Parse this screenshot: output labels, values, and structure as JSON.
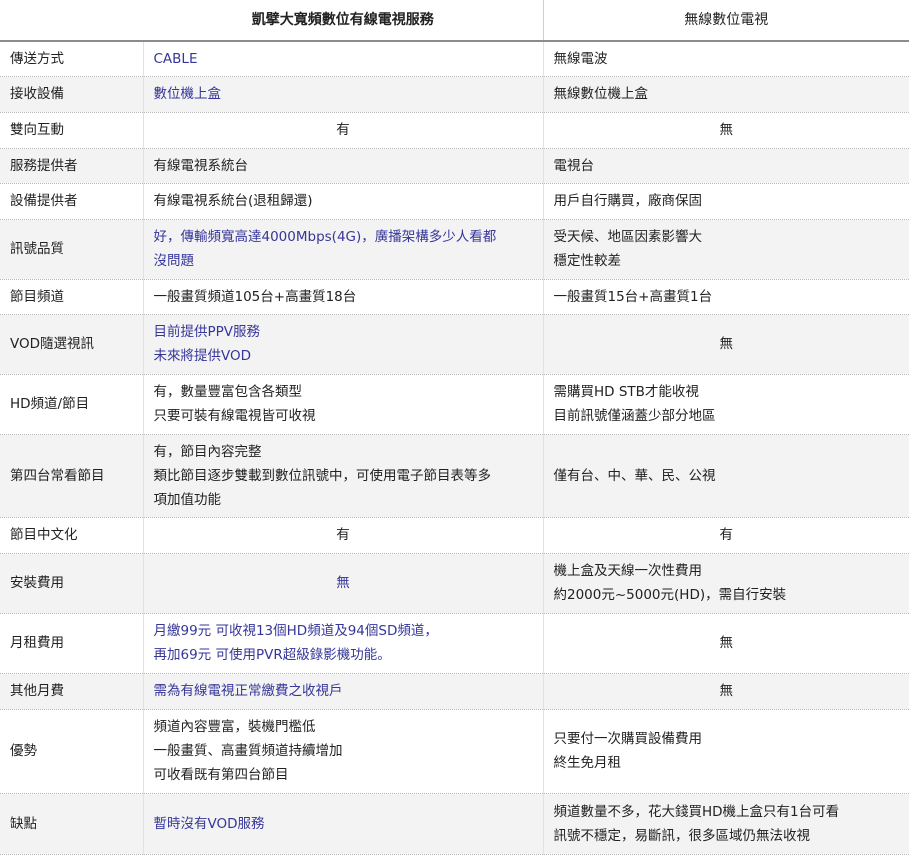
{
  "header": {
    "col0": "",
    "col1": "凱擘大寬頻數位有線電視服務",
    "col2": "無線數位電視"
  },
  "rows": [
    {
      "label": "傳送方式",
      "c1": [
        "CABLE"
      ],
      "c2": [
        "無線電波"
      ]
    },
    {
      "label": "接收設備",
      "c1": [
        "數位機上盒"
      ],
      "c2": [
        "無線數位機上盒"
      ]
    },
    {
      "label": "雙向互動",
      "c1": [
        "有"
      ],
      "c2": [
        "無"
      ]
    },
    {
      "label": "服務提供者",
      "c1": [
        "有線電視系統台"
      ],
      "c2": [
        "電視台"
      ]
    },
    {
      "label": "設備提供者",
      "c1": [
        "有線電視系統台(退租歸還)"
      ],
      "c2": [
        "用戶自行購買，廠商保固"
      ]
    },
    {
      "label": "訊號品質",
      "c1": [
        "好，傳輸頻寬高達4000Mbps(4G)，廣播架構多少人看都",
        "沒問題"
      ],
      "c2": [
        "受天候、地區因素影響大",
        "穩定性較差"
      ]
    },
    {
      "label": "節目頻道",
      "c1": [
        "一般畫質頻道105台+高畫質18台"
      ],
      "c2": [
        "一般畫質15台+高畫質1台"
      ]
    },
    {
      "label": "VOD隨選視訊",
      "c1": [
        "目前提供PPV服務",
        "未來將提供VOD"
      ],
      "c2": [
        "無"
      ]
    },
    {
      "label": "HD頻道/節目",
      "c1": [
        "有，數量豐富包含各類型",
        "只要可裝有線電視皆可收視"
      ],
      "c2": [
        "需購買HD STB才能收視",
        "目前訊號僅涵蓋少部分地區"
      ]
    },
    {
      "label": "第四台常看節目",
      "c1": [
        "有，節目內容完整",
        "類比節目逐步雙載到數位訊號中，可使用電子節目表等多",
        "項加值功能"
      ],
      "c2": [
        "僅有台、中、華、民、公視"
      ]
    },
    {
      "label": "節目中文化",
      "c1": [
        "有"
      ],
      "c2": [
        "有"
      ]
    },
    {
      "label": "安裝費用",
      "c1": [
        "無"
      ],
      "c2": [
        "機上盒及天線一次性費用",
        "約2000元~5000元(HD)，需自行安裝"
      ]
    },
    {
      "label": "月租費用",
      "c1": [
        "月繳99元 可收視13個HD頻道及94個SD頻道，",
        "再加69元 可使用PVR超級錄影機功能。"
      ],
      "c2": [
        "無"
      ]
    },
    {
      "label": "其他月費",
      "c1": [
        "需為有線電視正常繳費之收視戶"
      ],
      "c2": [
        "無"
      ]
    },
    {
      "label": "優勢",
      "c1": [
        "頻道內容豐富，裝機門檻低",
        "一般畫質、高畫質頻道持續增加",
        "可收看既有第四台節目"
      ],
      "c2": [
        "只要付一次購買設備費用",
        "終生免月租"
      ]
    },
    {
      "label": "缺點",
      "c1": [
        "暫時沒有VOD服務"
      ],
      "c2": [
        "頻道數量不多，花大錢買HD機上盒只有1台可看",
        "訊號不穩定，易斷訊，很多區域仍無法收視"
      ]
    }
  ]
}
